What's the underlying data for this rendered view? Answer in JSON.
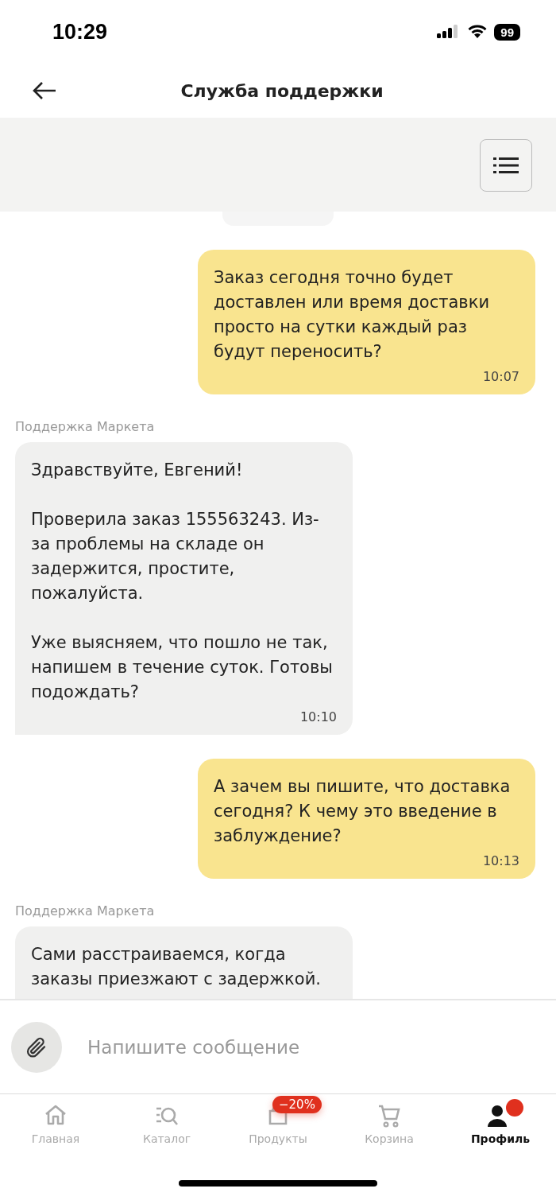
{
  "status_bar": {
    "time": "10:29",
    "battery": "99"
  },
  "header": {
    "title": "Служба поддержки"
  },
  "messages": [
    {
      "kind": "outgoing",
      "text": "Заказ сегодня точно будет доставлен или время доставки просто на сутки каждый раз будут переносить?",
      "time": "10:07"
    },
    {
      "kind": "incoming",
      "sender": "Поддержка Маркета",
      "text": "Здравствуйте, Евгений!\n\nПроверила заказ 155563243. Из-за проблемы на складе он задержится, простите, пожалуйста.\n\nУже выясняем, что пошло не так, напишем в течение суток. Готовы подождать?",
      "time": "10:10"
    },
    {
      "kind": "outgoing",
      "text": "А зачем вы пишите, что доставка сегодня? К чему это введение в заблуждение?",
      "time": "10:13"
    },
    {
      "kind": "incoming",
      "sender": "Поддержка Маркета",
      "text": "Сами расстраиваемся, когда заказы приезжают с задержкой."
    }
  ],
  "composer": {
    "placeholder": "Напишите сообщение"
  },
  "nav": [
    {
      "kind": "home",
      "label": "Главная",
      "selected": false
    },
    {
      "kind": "catalog",
      "label": "Каталог",
      "selected": false
    },
    {
      "kind": "products",
      "label": "Продукты",
      "selected": false,
      "badge": "−20%"
    },
    {
      "kind": "cart",
      "label": "Корзина",
      "selected": false
    },
    {
      "kind": "profile",
      "label": "Профиль",
      "selected": true,
      "dot": true
    }
  ]
}
